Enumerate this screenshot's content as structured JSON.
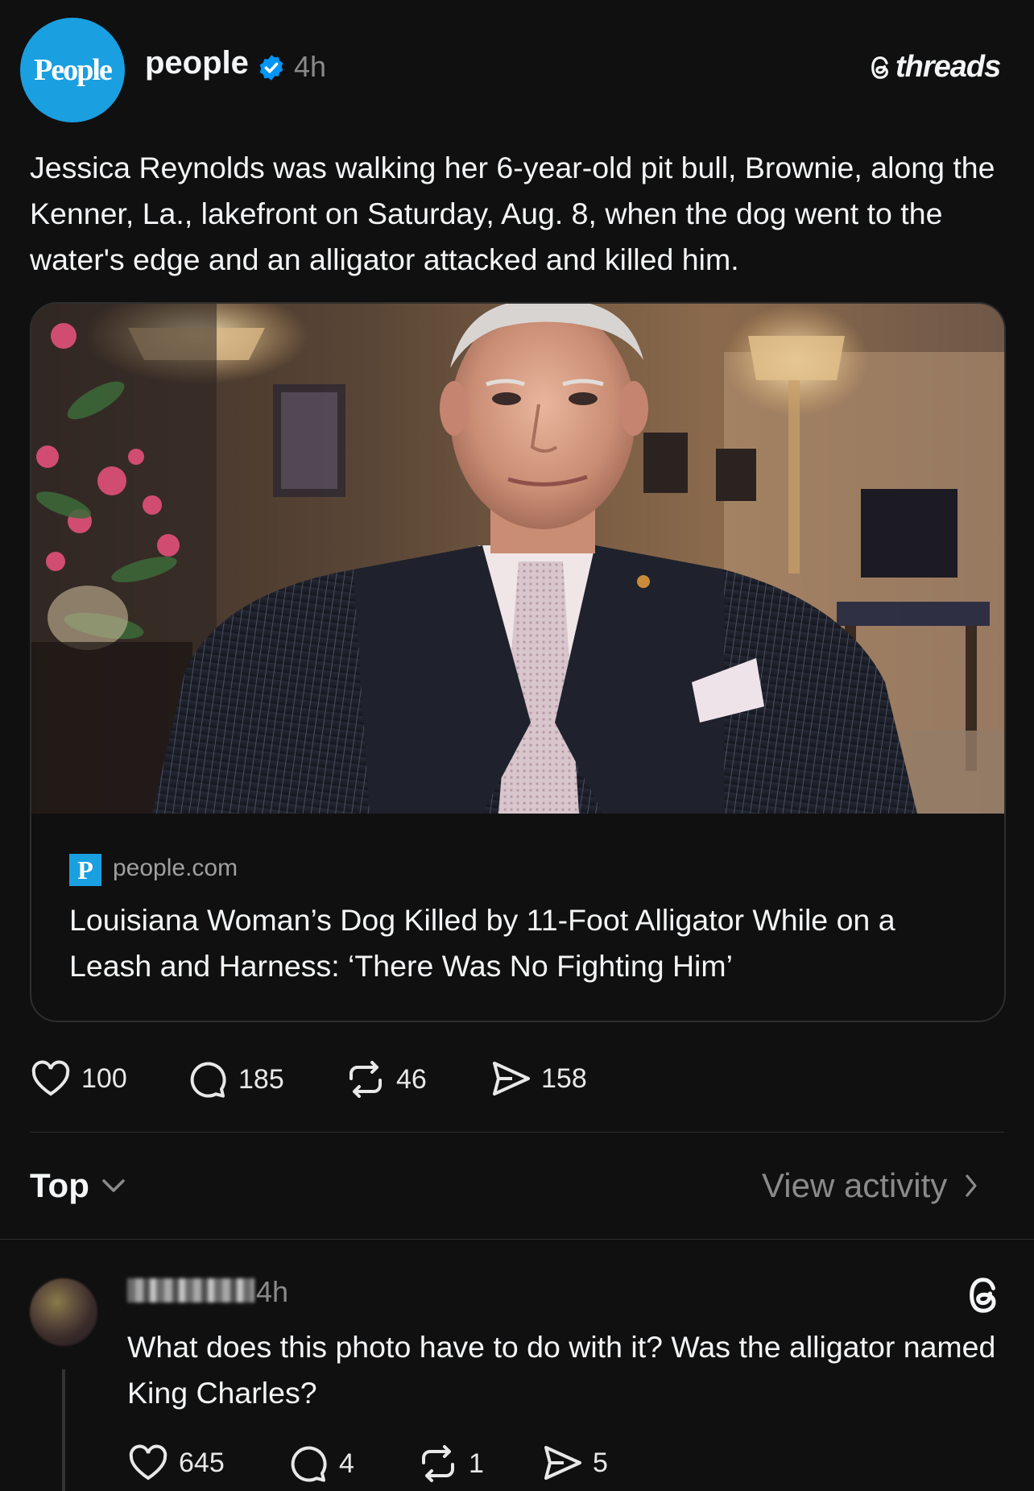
{
  "post": {
    "avatar_text": "People",
    "username": "people",
    "verified_icon": "verified-badge-icon",
    "time": "4h",
    "brand": "threads",
    "text": "Jessica Reynolds was walking her 6-year-old pit bull, Brownie, along the Kenner, La., lakefront on Saturday, Aug. 8, when the dog went to the water's edge and an alligator attacked and killed him."
  },
  "link_card": {
    "site_icon_letter": "P",
    "domain": "people.com",
    "title": "Louisiana Woman’s Dog Killed by 11-Foot Alligator While on a Leash and Harness: ‘There Was No Fighting Him’"
  },
  "actions": {
    "likes": "100",
    "replies": "185",
    "reposts": "46",
    "shares": "158"
  },
  "sort": {
    "label": "Top",
    "view_activity": "View activity"
  },
  "reply": {
    "username": "",
    "time": "4h",
    "text": "What does this photo have to do with it? Was the alligator named King Charles?",
    "actions": {
      "likes": "645",
      "replies": "4",
      "reposts": "1",
      "shares": "5"
    }
  },
  "colors": {
    "background": "#101010",
    "text": "#f3f5f7",
    "muted": "#8a8a8a",
    "people_blue": "#1a9fe0",
    "verified_blue": "#0095f6"
  }
}
